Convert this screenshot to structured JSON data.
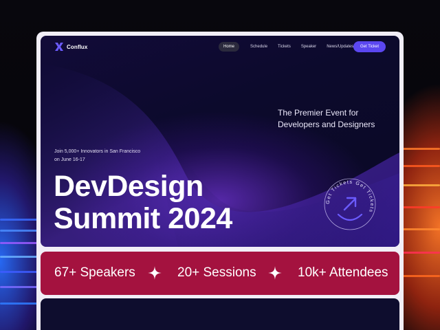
{
  "brand": {
    "name": "Conflux"
  },
  "nav": {
    "items": [
      {
        "label": "Home",
        "active": true
      },
      {
        "label": "Schedule"
      },
      {
        "label": "Tickets"
      },
      {
        "label": "Speaker"
      },
      {
        "label": "News/Updates"
      }
    ],
    "cta_label": "Get Ticket"
  },
  "hero": {
    "tagline": "The Premier Event for Developers and Designers",
    "intro": "Join 5,000+ Innovators in San Francisco on June 16-17",
    "title_line1": "DevDesign",
    "title_line2": "Summit 2024",
    "badge_text": "Get Tickets Get Tickets"
  },
  "stats": [
    {
      "label": "67+ Speakers"
    },
    {
      "label": "20+ Sessions"
    },
    {
      "label": "10k+ Attendees"
    }
  ],
  "colors": {
    "accent": "#5b47f0",
    "stats_bg": "#a4123f",
    "hero_bg": "#0c0a2c",
    "frame_bg": "#f1eef7"
  }
}
